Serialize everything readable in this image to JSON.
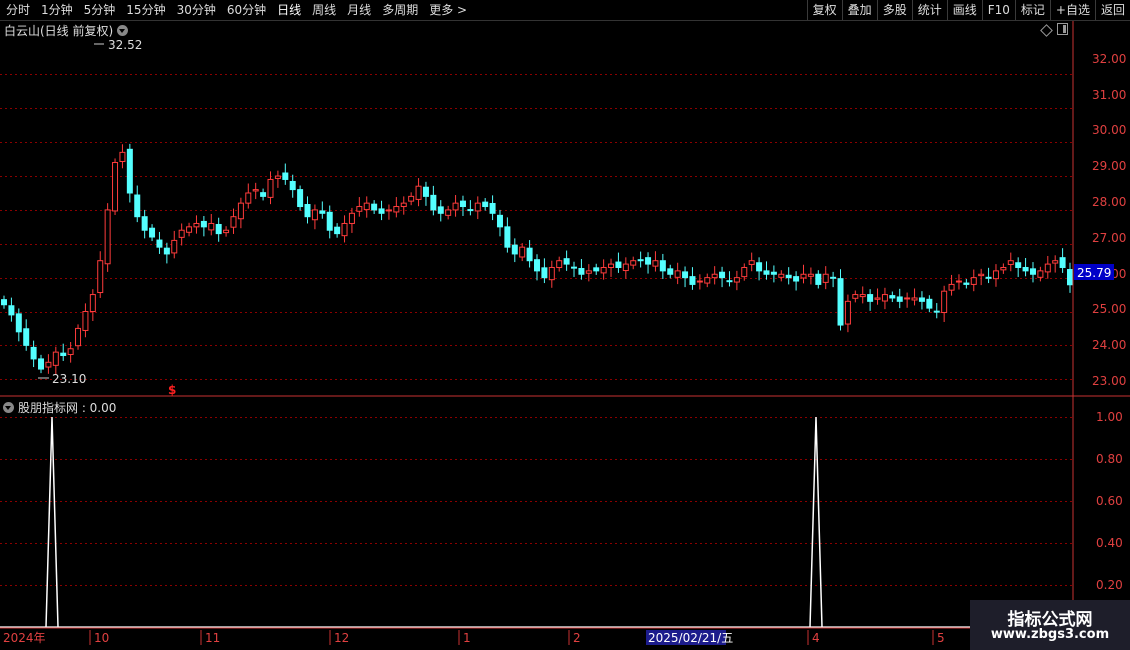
{
  "toolbar": {
    "periods": [
      "分时",
      "1分钟",
      "5分钟",
      "15分钟",
      "30分钟",
      "60分钟",
      "日线",
      "周线",
      "月线",
      "多周期",
      "更多 >"
    ],
    "active_period": "日线",
    "tools": [
      "复权",
      "叠加",
      "多股",
      "统计",
      "画线",
      "F10",
      "标记",
      "+自选",
      "返回"
    ]
  },
  "chart": {
    "title": "白云山(日线 前复权)",
    "high_label": "32.52",
    "low_label": "23.10",
    "current_price": "25.79",
    "marker": "$",
    "up_color": "#ff3c3c",
    "down_color": "#54ffff",
    "grid_color": "#8b0000",
    "axis_color": "#c83232",
    "price_ticks": [
      "32.00",
      "31.00",
      "30.00",
      "29.00",
      "28.00",
      "27.00",
      "26.00",
      "25.00",
      "24.00",
      "23.00"
    ]
  },
  "indicator": {
    "title": "股朋指标网 : 0.00",
    "ticks": [
      "1.00",
      "0.80",
      "0.60",
      "0.40",
      "0.20"
    ]
  },
  "time_axis": {
    "labels": [
      "2024年",
      "10",
      "11",
      "12",
      "1",
      "2",
      "2025/02/21/五",
      "4",
      "5"
    ],
    "cursor_label": "2025/02/21/五"
  },
  "watermark": {
    "title": "指标公式网",
    "url": "www.zbgs3.com"
  },
  "chart_data": [
    {
      "type": "candlestick",
      "title": "白云山(日线 前复权)",
      "ylim": [
        22.8,
        32.9
      ],
      "annotations": [
        {
          "label": "32.52",
          "value": 32.52
        },
        {
          "label": "23.10",
          "value": 23.1
        }
      ],
      "current_price": 25.79,
      "closes": [
        25.2,
        24.9,
        24.4,
        24.0,
        23.6,
        23.3,
        23.5,
        23.8,
        23.7,
        23.9,
        24.5,
        25.0,
        25.5,
        26.5,
        28.0,
        29.4,
        29.7,
        28.5,
        27.8,
        27.4,
        27.2,
        26.9,
        26.7,
        27.1,
        27.4,
        27.5,
        27.6,
        27.5,
        27.6,
        27.3,
        27.4,
        27.8,
        28.2,
        28.5,
        28.6,
        28.4,
        28.9,
        29.0,
        28.9,
        28.6,
        28.1,
        27.8,
        28.0,
        27.9,
        27.4,
        27.3,
        27.6,
        27.9,
        28.1,
        28.2,
        28.0,
        27.9,
        28.0,
        28.1,
        28.2,
        28.4,
        28.7,
        28.4,
        28.0,
        27.9,
        28.0,
        28.2,
        28.1,
        28.0,
        28.2,
        28.1,
        27.9,
        27.5,
        26.9,
        26.7,
        26.9,
        26.5,
        26.2,
        26.0,
        26.3,
        26.5,
        26.4,
        26.3,
        26.1,
        26.2,
        26.2,
        26.3,
        26.4,
        26.3,
        26.4,
        26.5,
        26.5,
        26.4,
        26.5,
        26.2,
        26.1,
        26.2,
        26.0,
        25.8,
        25.9,
        26.0,
        26.1,
        26.0,
        25.9,
        26.0,
        26.3,
        26.5,
        26.2,
        26.1,
        26.1,
        26.1,
        26.0,
        25.9,
        26.1,
        26.1,
        25.8,
        26.1,
        26.0,
        24.6,
        25.3,
        25.5,
        25.5,
        25.3,
        25.4,
        25.5,
        25.4,
        25.3,
        25.4,
        25.4,
        25.3,
        25.1,
        25.0,
        25.6,
        25.8,
        25.9,
        25.8,
        26.0,
        26.1,
        26.0,
        26.2,
        26.3,
        26.5,
        26.3,
        26.2,
        26.1,
        26.2,
        26.4,
        26.5,
        26.3,
        25.79
      ],
      "indicator_spikes": [
        {
          "value": 1.0
        },
        {
          "value": 1.0
        }
      ]
    }
  ]
}
